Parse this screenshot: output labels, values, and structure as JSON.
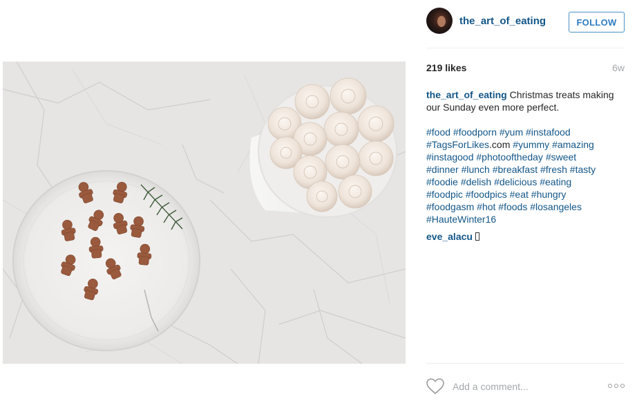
{
  "post": {
    "photo_icon": "food-photo",
    "header": {
      "username": "the_art_of_eating",
      "follow_label": "FOLLOW",
      "avatar_icon": "profile-avatar"
    },
    "likes": "219 likes",
    "age": "6w",
    "caption": {
      "username": "the_art_of_eating",
      "text": "Christmas treats making our Sunday even more perfect."
    },
    "hashtags": {
      "line1": "#food #foodporn #yum #instafood",
      "line2_tag": "#TagsForLikes",
      "line2_plain": ".com",
      "line2_rest": " #yummy #amazing",
      "line3": "#instagood #photooftheday #sweet",
      "line4": "#dinner #lunch #breakfast #fresh #tasty",
      "line5": "#foodie #delish #delicious #eating",
      "line6": "#foodpic #foodpics #eat #hungry",
      "line7": "#foodgasm #hot #foods #losangeles",
      "line8": "#HauteWinter16"
    },
    "comment": {
      "username": "eve_alacu",
      "emoji_icon": "unknown-glyph"
    },
    "comment_bar": {
      "like_icon": "heart-outline-icon",
      "placeholder": "Add a comment...",
      "more_icon": "more-options-icon"
    },
    "colors": {
      "link_blue": "#125688",
      "follow_blue": "#2e7bc4",
      "muted_gray": "#a5a7aa"
    }
  }
}
